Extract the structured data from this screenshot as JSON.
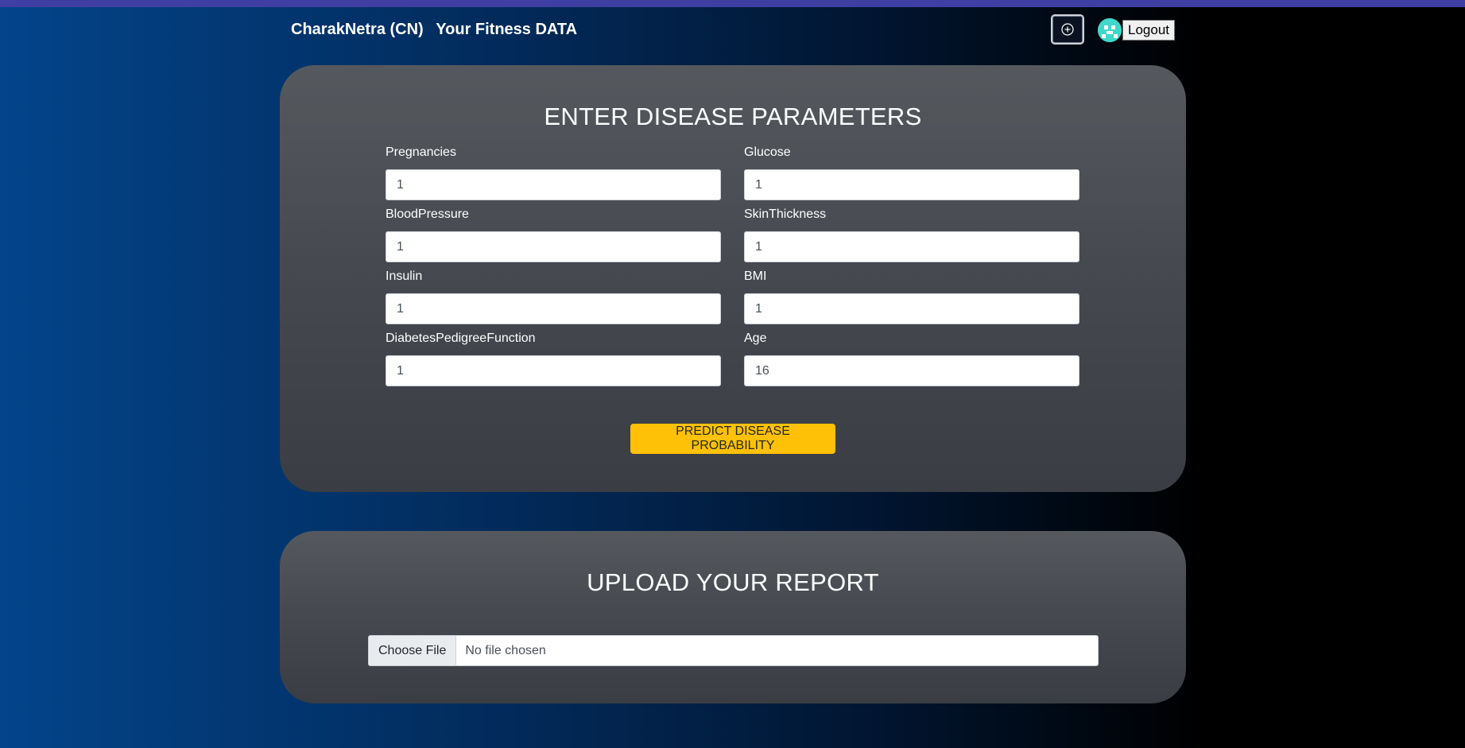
{
  "navbar": {
    "brand": "CharakNetra (CN)",
    "subtitle": "Your Fitness DATA",
    "add_icon": "plus-circle-icon",
    "logout_label": "Logout"
  },
  "form": {
    "title": "ENTER DISEASE PARAMETERS",
    "fields": [
      {
        "label": "Pregnancies",
        "value": "1"
      },
      {
        "label": "Glucose",
        "value": "1"
      },
      {
        "label": "BloodPressure",
        "value": "1"
      },
      {
        "label": "SkinThickness",
        "value": "1"
      },
      {
        "label": "Insulin",
        "value": "1"
      },
      {
        "label": "BMI",
        "value": "1"
      },
      {
        "label": "DiabetesPedigreeFunction",
        "value": "1"
      },
      {
        "label": "Age",
        "value": "16"
      }
    ],
    "submit_label": "PREDICT DISEASE PROBABILITY"
  },
  "upload": {
    "title": "UPLOAD YOUR REPORT",
    "choose_label": "Choose File",
    "status": "No file chosen"
  },
  "colors": {
    "accent": "#ffc107",
    "top_strip": "#3f3fa3",
    "card": "#4a4e54"
  }
}
